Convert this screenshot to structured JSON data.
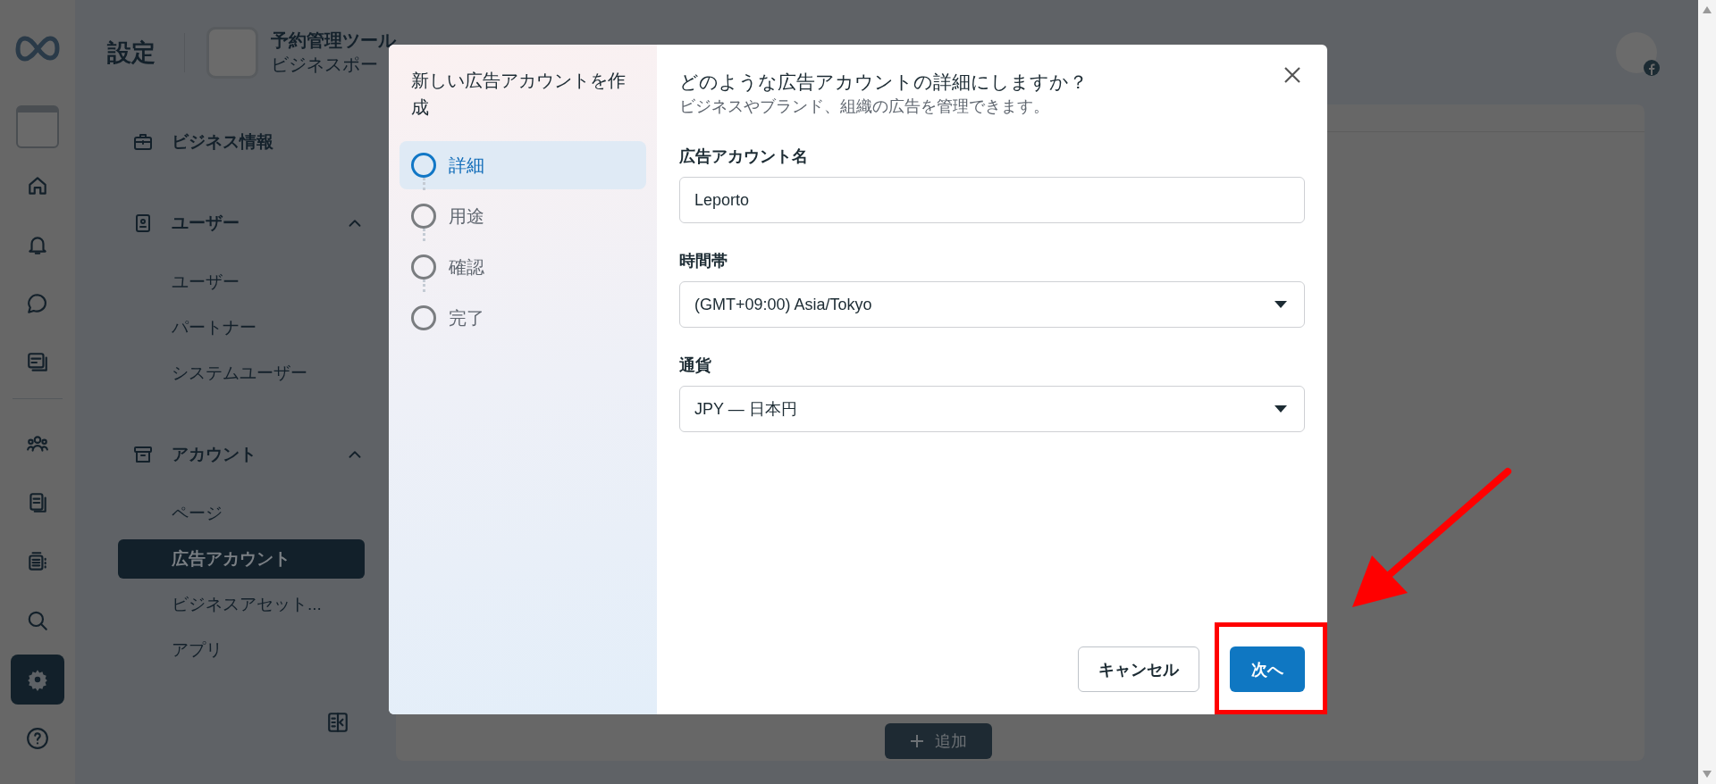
{
  "rail": {
    "top": [
      {
        "kind": "business",
        "selected": false
      },
      {
        "kind": "home",
        "selected": false
      },
      {
        "kind": "bell",
        "selected": false
      },
      {
        "kind": "chat",
        "selected": false
      },
      {
        "kind": "pages",
        "selected": false
      }
    ],
    "bottom": [
      {
        "kind": "people",
        "selected": false
      },
      {
        "kind": "docs",
        "selected": false
      },
      {
        "kind": "grid",
        "selected": false
      },
      {
        "kind": "search",
        "selected": false
      },
      {
        "kind": "settings",
        "selected": true
      },
      {
        "kind": "help",
        "selected": false
      }
    ]
  },
  "header": {
    "title": "設定",
    "business_name": "予約管理ツール",
    "business_subtitle": "ビジネスポー"
  },
  "sidebar": {
    "sections": [
      {
        "kind": "briefcase",
        "label": "ビジネス情報"
      },
      {
        "kind": "user-card",
        "label": "ユーザー",
        "expanded": true,
        "children": [
          {
            "label": "ユーザー",
            "selected": false
          },
          {
            "label": "パートナー",
            "selected": false
          },
          {
            "label": "システムユーザー",
            "selected": false
          }
        ]
      },
      {
        "kind": "archive",
        "label": "アカウント",
        "expanded": true,
        "children": [
          {
            "label": "ページ",
            "selected": false
          },
          {
            "label": "広告アカウント",
            "selected": true
          },
          {
            "label": "ビジネスアセット...",
            "selected": false
          },
          {
            "label": "アプリ",
            "selected": false
          }
        ]
      }
    ]
  },
  "main": {
    "add_button": "追加"
  },
  "modal": {
    "title": "新しい広告アカウントを作成",
    "steps": [
      {
        "label": "詳細",
        "selected": true
      },
      {
        "label": "用途",
        "selected": false
      },
      {
        "label": "確認",
        "selected": false
      },
      {
        "label": "完了",
        "selected": false
      }
    ],
    "heading": "どのような広告アカウントの詳細にしますか？",
    "subheading": "ビジネスやブランド、組織の広告を管理できます。",
    "fields": [
      {
        "kind": "text",
        "label": "広告アカウント名",
        "value": "Leporto"
      },
      {
        "kind": "select",
        "label": "時間帯",
        "value": "(GMT+09:00) Asia/Tokyo"
      },
      {
        "kind": "select",
        "label": "通貨",
        "value": "JPY — 日本円"
      }
    ],
    "buttons": [
      {
        "kind": "secondary",
        "label": "キャンセル"
      },
      {
        "kind": "primary",
        "label": "次へ"
      }
    ]
  }
}
